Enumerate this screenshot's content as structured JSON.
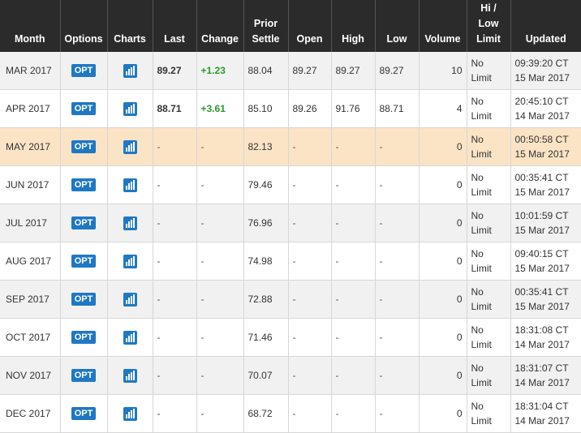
{
  "headers": {
    "month": "Month",
    "options": "Options",
    "charts": "Charts",
    "last": "Last",
    "change": "Change",
    "prior_settle_1": "Prior",
    "prior_settle_2": "Settle",
    "open": "Open",
    "high": "High",
    "low": "Low",
    "volume": "Volume",
    "hilo_1": "Hi /",
    "hilo_2": "Low",
    "hilo_3": "Limit",
    "updated": "Updated"
  },
  "opt_label": "OPT",
  "chart_icon": "bar-chart-icon",
  "colors": {
    "header_bg": "#2b2b2b",
    "opt_bg": "#1f78c4",
    "positive": "#2c9a2c",
    "highlight_row": "#fbe3c6"
  },
  "rows": [
    {
      "month": "MAR 2017",
      "last": "89.27",
      "change": "+1.23",
      "prior": "88.04",
      "open": "89.27",
      "high": "89.27",
      "low": "89.27",
      "volume": "10",
      "limit1": "No",
      "limit2": "Limit",
      "time": "09:39:20 CT",
      "date": "15 Mar 2017"
    },
    {
      "month": "APR 2017",
      "last": "88.71",
      "change": "+3.61",
      "prior": "85.10",
      "open": "89.26",
      "high": "91.76",
      "low": "88.71",
      "volume": "4",
      "limit1": "No",
      "limit2": "Limit",
      "time": "20:45:10 CT",
      "date": "14 Mar 2017"
    },
    {
      "month": "MAY 2017",
      "last": "-",
      "change": "-",
      "prior": "82.13",
      "open": "-",
      "high": "-",
      "low": "-",
      "volume": "0",
      "limit1": "No",
      "limit2": "Limit",
      "time": "00:50:58 CT",
      "date": "15 Mar 2017"
    },
    {
      "month": "JUN 2017",
      "last": "-",
      "change": "-",
      "prior": "79.46",
      "open": "-",
      "high": "-",
      "low": "-",
      "volume": "0",
      "limit1": "No",
      "limit2": "Limit",
      "time": "00:35:41 CT",
      "date": "15 Mar 2017"
    },
    {
      "month": "JUL 2017",
      "last": "-",
      "change": "-",
      "prior": "76.96",
      "open": "-",
      "high": "-",
      "low": "-",
      "volume": "0",
      "limit1": "No",
      "limit2": "Limit",
      "time": "10:01:59 CT",
      "date": "15 Mar 2017"
    },
    {
      "month": "AUG 2017",
      "last": "-",
      "change": "-",
      "prior": "74.98",
      "open": "-",
      "high": "-",
      "low": "-",
      "volume": "0",
      "limit1": "No",
      "limit2": "Limit",
      "time": "09:40:15 CT",
      "date": "15 Mar 2017"
    },
    {
      "month": "SEP 2017",
      "last": "-",
      "change": "-",
      "prior": "72.88",
      "open": "-",
      "high": "-",
      "low": "-",
      "volume": "0",
      "limit1": "No",
      "limit2": "Limit",
      "time": "00:35:41 CT",
      "date": "15 Mar 2017"
    },
    {
      "month": "OCT 2017",
      "last": "-",
      "change": "-",
      "prior": "71.46",
      "open": "-",
      "high": "-",
      "low": "-",
      "volume": "0",
      "limit1": "No",
      "limit2": "Limit",
      "time": "18:31:08 CT",
      "date": "14 Mar 2017"
    },
    {
      "month": "NOV 2017",
      "last": "-",
      "change": "-",
      "prior": "70.07",
      "open": "-",
      "high": "-",
      "low": "-",
      "volume": "0",
      "limit1": "No",
      "limit2": "Limit",
      "time": "18:31:07 CT",
      "date": "14 Mar 2017"
    },
    {
      "month": "DEC 2017",
      "last": "-",
      "change": "-",
      "prior": "68.72",
      "open": "-",
      "high": "-",
      "low": "-",
      "volume": "0",
      "limit1": "No",
      "limit2": "Limit",
      "time": "18:31:04 CT",
      "date": "14 Mar 2017"
    }
  ]
}
